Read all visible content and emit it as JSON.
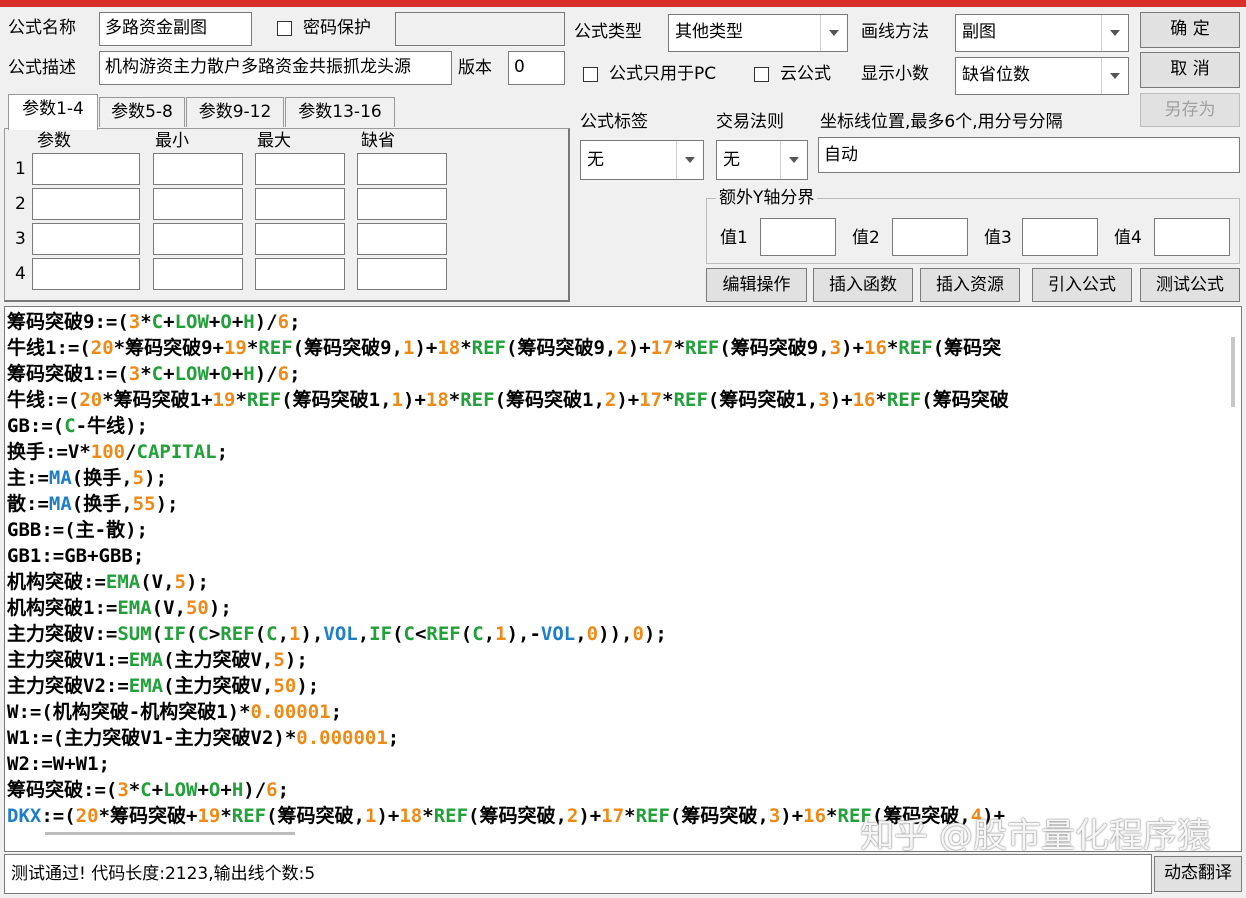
{
  "form": {
    "name_label": "公式名称",
    "name_value": "多路资金副图",
    "password_label": "密码保护",
    "desc_label": "公式描述",
    "desc_value": "机构游资主力散户多路资金共振抓龙头源",
    "version_label": "版本",
    "version_value": "0",
    "type_label": "公式类型",
    "type_value": "其他类型",
    "draw_label": "画线方法",
    "draw_value": "副图",
    "pc_only_label": "公式只用于PC",
    "cloud_label": "云公式",
    "decimals_label": "显示小数",
    "decimals_value": "缺省位数",
    "tag_label": "公式标签",
    "tag_value": "无",
    "rule_label": "交易法则",
    "rule_value": "无",
    "coord_label": "坐标线位置,最多6个,用分号分隔",
    "coord_value": "自动",
    "yaxis_group_label": "额外Y轴分界",
    "yaxis_labels": [
      "值1",
      "值2",
      "值3",
      "值4"
    ]
  },
  "buttons": {
    "ok": "确  定",
    "cancel": "取  消",
    "save_as": "另存为",
    "edit_op": "编辑操作",
    "insert_func": "插入函数",
    "insert_res": "插入资源",
    "import_formula": "引入公式",
    "test_formula": "测试公式",
    "dynamic_translate": "动态翻译"
  },
  "tabs": [
    "参数1-4",
    "参数5-8",
    "参数9-12",
    "参数13-16"
  ],
  "params": {
    "headers": [
      "参数",
      "最小",
      "最大",
      "缺省"
    ],
    "rows": [
      "1",
      "2",
      "3",
      "4"
    ]
  },
  "code_lines": [
    "筹码突破9:=(3*C+LOW+O+H)/6;",
    "牛线1:=(20*筹码突破9+19*REF(筹码突破9,1)+18*REF(筹码突破9,2)+17*REF(筹码突破9,3)+16*REF(筹码突",
    "筹码突破1:=(3*C+LOW+O+H)/6;",
    "牛线:=(20*筹码突破1+19*REF(筹码突破1,1)+18*REF(筹码突破1,2)+17*REF(筹码突破1,3)+16*REF(筹码突破",
    "GB:=(C-牛线);",
    "换手:=V*100/CAPITAL;",
    "主:=MA(换手,5);",
    "散:=MA(换手,55);",
    "GBB:=(主-散);",
    "GB1:=GB+GBB;",
    "机构突破:=EMA(V,5);",
    "机构突破1:=EMA(V,50);",
    "主力突破V:=SUM(IF(C>REF(C,1),VOL,IF(C<REF(C,1),-VOL,0)),0);",
    "主力突破V1:=EMA(主力突破V,5);",
    "主力突破V2:=EMA(主力突破V,50);",
    "W:=(机构突破-机构突破1)*0.00001;",
    "W1:=(主力突破V1-主力突破V2)*0.000001;",
    "W2:=W+W1;",
    "筹码突破:=(3*C+LOW+O+H)/6;",
    "DKX:=(20*筹码突破+19*REF(筹码突破,1)+18*REF(筹码突破,2)+17*REF(筹码突破,3)+16*REF(筹码突破,4)+"
  ],
  "status_text": "测试通过! 代码长度:2123,输出线个数:5",
  "watermark": "知乎 @股市量化程序猿"
}
